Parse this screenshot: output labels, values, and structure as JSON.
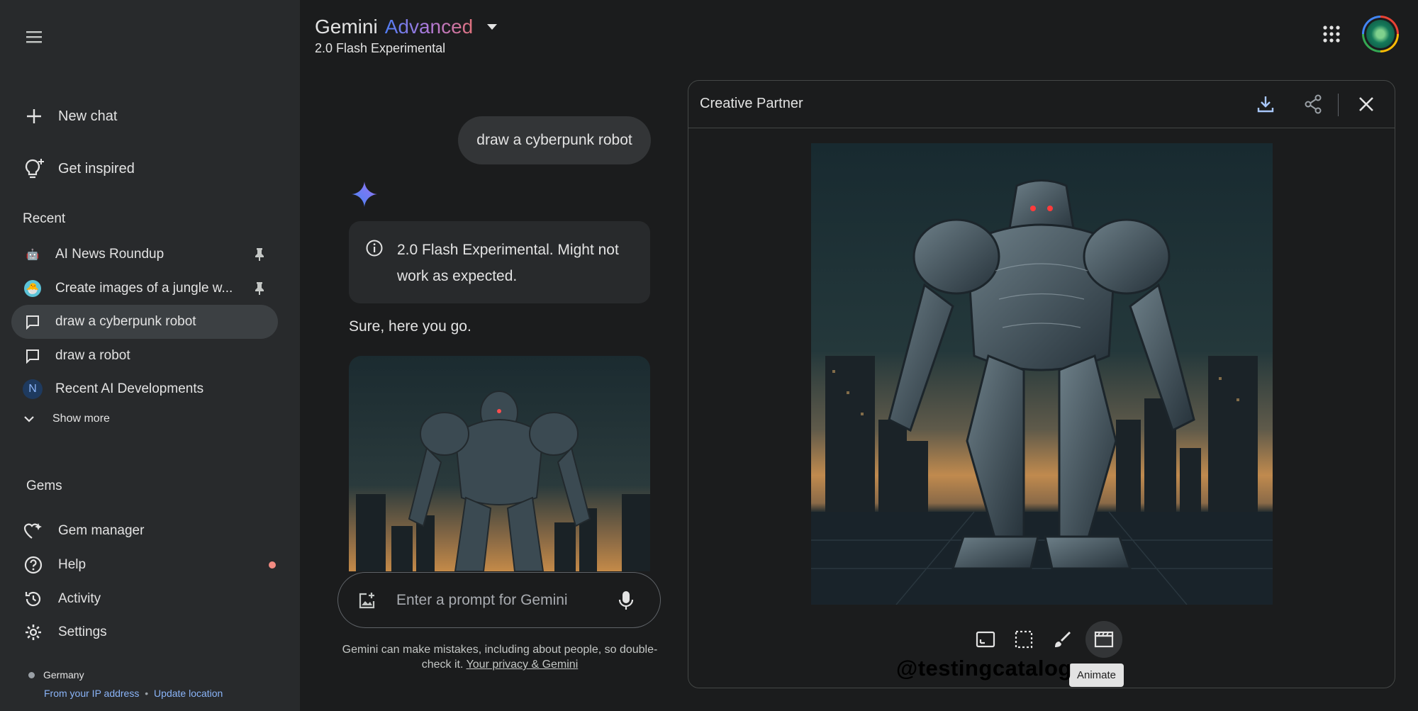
{
  "header": {
    "title": "Gemini",
    "title_tier": "Advanced",
    "model": "2.0 Flash Experimental"
  },
  "sidebar": {
    "new_chat": "New chat",
    "get_inspired": "Get inspired",
    "recent_title": "Recent",
    "recent": [
      {
        "label": "AI News Roundup",
        "icon": "robot-emoji",
        "pinned": true
      },
      {
        "label": "Create images of a jungle w...",
        "icon": "creature-emoji",
        "pinned": true
      },
      {
        "label": "draw a cyberpunk robot",
        "icon": "chat-icon",
        "active": true
      },
      {
        "label": "draw a robot",
        "icon": "chat-icon"
      },
      {
        "label": "Recent AI Developments",
        "icon": "N"
      }
    ],
    "show_more": "Show more",
    "gems_title": "Gems",
    "gem_items": [
      {
        "label": "Gem manager",
        "icon": "gem-manager-icon"
      },
      {
        "label": "Help",
        "icon": "help-icon"
      },
      {
        "label": "Activity",
        "icon": "history-icon"
      },
      {
        "label": "Settings",
        "icon": "gear-icon"
      }
    ],
    "location": {
      "country": "Germany",
      "source": "From your IP address",
      "separator": "•",
      "update": "Update location"
    }
  },
  "chat": {
    "user_message": "draw a cyberpunk robot",
    "notice": "2.0 Flash Experimental. Might not work as expected.",
    "reply": "Sure, here you go.",
    "prompt_placeholder": "Enter a prompt for Gemini",
    "disclaimer": "Gemini can make mistakes, including about people, so double-check it.",
    "privacy_link": "Your privacy & Gemini"
  },
  "canvas": {
    "title": "Creative Partner",
    "tooltip": "Animate"
  },
  "watermark": "@testingcatalog",
  "colors": {
    "background": "#1b1c1d",
    "sidebar": "#282a2c",
    "active_item": "#3c4043",
    "accent_blue": "#8ab4f8",
    "help_dot": "#f28b82"
  }
}
